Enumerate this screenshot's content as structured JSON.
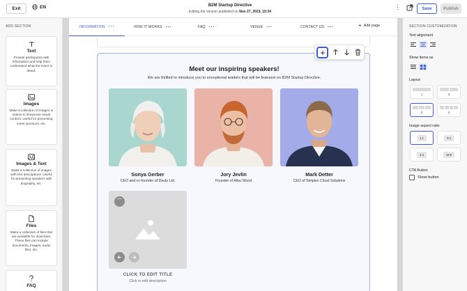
{
  "topbar": {
    "exit_label": "Exit",
    "lang_label": "EN",
    "title": "B2M Startup Directive",
    "subtitle_prefix": "Editing the version published on",
    "subtitle_date": "Nov 27, 2023, 10:34",
    "save_label": "Save",
    "publish_label": "Publish"
  },
  "left_panel": {
    "title": "ADD SECTION",
    "items": [
      {
        "name": "Text",
        "desc": "Provide participants with information and help them understand what the event is about.",
        "icon": "text-icon"
      },
      {
        "name": "Images",
        "desc": "Make a collection of images or videos to showcase visual content. Useful for presenting event sponsors, etc.",
        "icon": "image-icon"
      },
      {
        "name": "Images & Text",
        "desc": "Make a collection of images with text descriptions. Useful for presenting speakers with biography, etc.",
        "icon": "image-text-icon"
      },
      {
        "name": "Files",
        "desc": "Make a collection of files that are available for download. These files can include documents, images, audio files, etc.",
        "icon": "file-icon"
      },
      {
        "name": "FAQ",
        "desc": "",
        "icon": "question-icon"
      }
    ]
  },
  "nav": {
    "tabs": [
      {
        "label": "INFORMATION",
        "active": true
      },
      {
        "label": "HOW IT WORKS",
        "active": false
      },
      {
        "label": "FAQ",
        "active": false
      },
      {
        "label": "VENUE",
        "active": false
      },
      {
        "label": "CONTACT US",
        "active": false
      }
    ],
    "add_page_label": "Add page"
  },
  "section": {
    "title": "Meet our inspiring speakers!",
    "subtitle": "We are thrilled to introduce you to exceptional leaders that will be featured on B2M Startup Directive.",
    "speakers": [
      {
        "name": "Sonya Gerber",
        "role": "CEO and co-founder of Douty Ltd.",
        "photo_bg": "#a9d6cf"
      },
      {
        "name": "Jory Jevlin",
        "role": "Founder of Altuc Mond",
        "photo_bg": "#eab3a7"
      },
      {
        "name": "Mark Detter",
        "role": "CEO of Simplex Cloud Solutions",
        "photo_bg": "#a3ace9"
      }
    ],
    "placeholder": {
      "title": "CLICK TO EDIT TITLE",
      "desc": "Click to edit description"
    }
  },
  "right_panel": {
    "title": "SECTION CUSTOMIZATION",
    "text_alignment_label": "Text alignment",
    "show_items_label": "Show items as",
    "layout_label": "Layout",
    "layout_options": [
      "1",
      "2",
      "3",
      "4"
    ],
    "layout_selected": "3",
    "aspect_label": "Image aspect ratio",
    "aspect_options": [
      "1:1",
      "3:4",
      "4:3",
      "16:9"
    ],
    "aspect_selected": "1:1",
    "cta_label": "CTA Button",
    "show_button_label": "Show button"
  },
  "colors": {
    "accent": "#3b5bdb",
    "section_border": "#9fb0ef"
  }
}
